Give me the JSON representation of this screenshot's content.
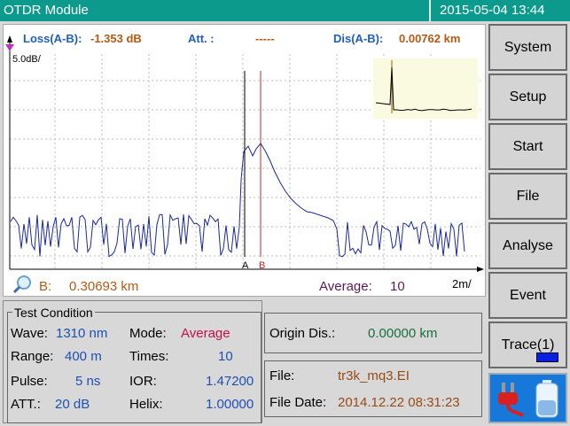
{
  "titlebar": {
    "app": "OTDR Module",
    "clock": "2015-05-04  13:44"
  },
  "measure": {
    "loss_label": "Loss(A-B):",
    "loss_value": "-1.353 dB",
    "att_label": "Att.  :",
    "att_value": "-----",
    "dis_label": "Dis(A-B):",
    "dis_value": "0.00762 km"
  },
  "graph": {
    "y_scale": "5.0dB/",
    "x_scale": "2m/",
    "marker_a": "A",
    "marker_b": "B",
    "cursor_label": "B:",
    "cursor_value": "0.30693 km",
    "average_label": "Average:",
    "average_value": "10"
  },
  "sidebar": {
    "buttons": [
      "System",
      "Setup",
      "Start",
      "File",
      "Analyse",
      "Event",
      "Trace(1)"
    ]
  },
  "condition": {
    "title": "Test Condition",
    "wave_label": "Wave:",
    "wave_value": "1310 nm",
    "mode_label": "Mode:",
    "mode_value": "Average",
    "range_label": "Range:",
    "range_value": "400  m",
    "times_label": "Times:",
    "times_value": "10",
    "pulse_label": "Pulse:",
    "pulse_value": "5 ns",
    "ior_label": "IOR:",
    "ior_value": "1.47200",
    "att_label": "ATT.:",
    "att_value": "20 dB",
    "helix_label": "Helix:",
    "helix_value": "1.00000"
  },
  "origin": {
    "label": "Origin Dis.:",
    "value": "0.00000 km"
  },
  "file": {
    "file_label": "File:",
    "file_value": "tr3k_mq3.EI",
    "date_label": "File Date:",
    "date_value": "2014.12.22 08:31:23"
  },
  "colors": {
    "title_bg": "#0c9a8c",
    "trace": "#1a2a9a",
    "marker_a": "#000000",
    "marker_b": "#cc2020",
    "status_bg": "#1678d8"
  },
  "icons": {
    "zoom": "magnifier-icon",
    "power": "power-plug-icon",
    "battery": "battery-icon"
  }
}
